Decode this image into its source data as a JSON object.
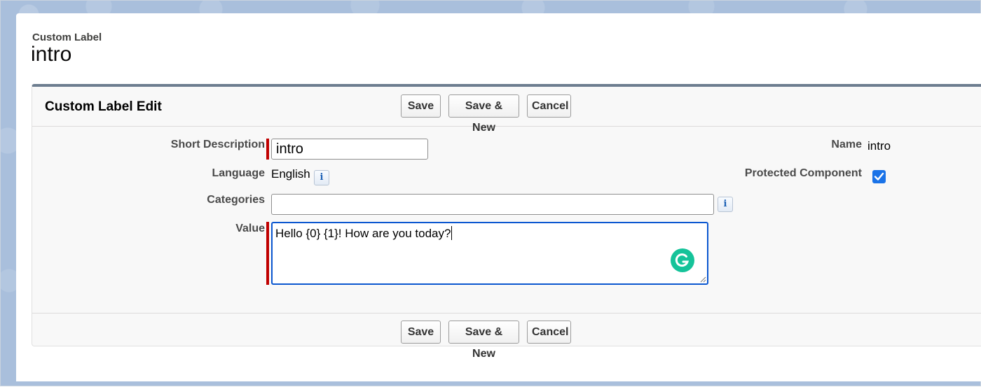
{
  "header": {
    "eyebrow": "Custom Label",
    "title": "intro"
  },
  "panel": {
    "title": "Custom Label Edit",
    "buttons": {
      "save": "Save",
      "save_new": "Save & New",
      "cancel": "Cancel"
    }
  },
  "form": {
    "short_description": {
      "label": "Short Description",
      "value": "intro"
    },
    "language": {
      "label": "Language",
      "value": "English",
      "info_icon": "info-icon"
    },
    "categories": {
      "label": "Categories",
      "value": "",
      "info_icon": "info-icon"
    },
    "value": {
      "label": "Value",
      "value": "Hello {0} {1}! How are you today?"
    },
    "name": {
      "label": "Name",
      "value": "intro"
    },
    "protected_component": {
      "label": "Protected Component",
      "checked": true,
      "icon": "checkmark-icon"
    }
  },
  "colors": {
    "required_bar": "#c00000",
    "checkbox": "#1a73e8",
    "textarea_focus_border": "#0b57d0",
    "grammarly": "#15c39a",
    "panel_top_border": "#6d7d8f"
  }
}
